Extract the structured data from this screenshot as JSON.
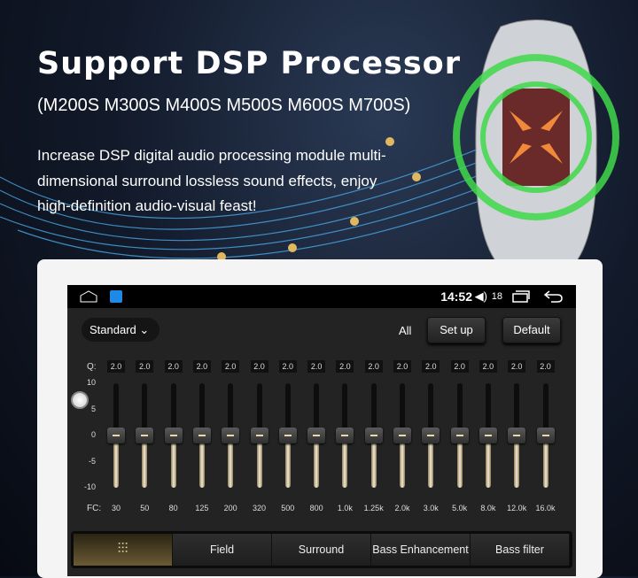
{
  "promo": {
    "title": "Support DSP Processor",
    "subtitle": "(M200S M300S M400S M500S M600S M700S)",
    "body": "Increase DSP digital audio processing module multi-dimensional surround lossless sound effects, enjoy high-definition audio-visual feast!"
  },
  "status_bar": {
    "time": "14:52",
    "volume": "18",
    "icons": [
      "home-icon",
      "app-icon",
      "volume-icon",
      "recents-icon",
      "back-icon"
    ]
  },
  "toolbar": {
    "preset": "Standard",
    "all_label": "All",
    "setup_label": "Set up",
    "default_label": "Default"
  },
  "eq": {
    "q_label": "Q:",
    "fc_label": "FC:",
    "axis": [
      "10",
      "5",
      "0",
      "-5",
      "-10"
    ],
    "bands": [
      {
        "fc": "30",
        "q": "2.0",
        "gain": 0
      },
      {
        "fc": "50",
        "q": "2.0",
        "gain": 0
      },
      {
        "fc": "80",
        "q": "2.0",
        "gain": 0
      },
      {
        "fc": "125",
        "q": "2.0",
        "gain": 0
      },
      {
        "fc": "200",
        "q": "2.0",
        "gain": 0
      },
      {
        "fc": "320",
        "q": "2.0",
        "gain": 0
      },
      {
        "fc": "500",
        "q": "2.0",
        "gain": 0
      },
      {
        "fc": "800",
        "q": "2.0",
        "gain": 0
      },
      {
        "fc": "1.0k",
        "q": "2.0",
        "gain": 0
      },
      {
        "fc": "1.25k",
        "q": "2.0",
        "gain": 0
      },
      {
        "fc": "2.0k",
        "q": "2.0",
        "gain": 0
      },
      {
        "fc": "3.0k",
        "q": "2.0",
        "gain": 0
      },
      {
        "fc": "5.0k",
        "q": "2.0",
        "gain": 0
      },
      {
        "fc": "8.0k",
        "q": "2.0",
        "gain": 0
      },
      {
        "fc": "12.0k",
        "q": "2.0",
        "gain": 0
      },
      {
        "fc": "16.0k",
        "q": "2.0",
        "gain": 0
      }
    ]
  },
  "tabs": [
    {
      "label": "",
      "icon": "equalizer-icon",
      "active": true
    },
    {
      "label": "Field"
    },
    {
      "label": "Surround"
    },
    {
      "label": "Bass Enhancement"
    },
    {
      "label": "Bass filter"
    }
  ],
  "colors": {
    "accent": "#e9d9a8",
    "screen_bg": "#232323",
    "ring": "#3fd94a"
  }
}
